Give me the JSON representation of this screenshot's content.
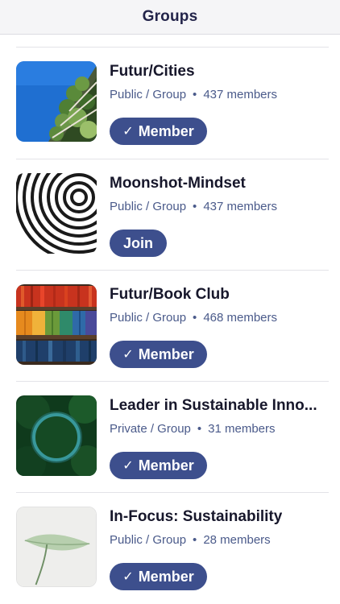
{
  "header": {
    "title": "Groups"
  },
  "colors": {
    "accent": "#3d4f8d",
    "meta_text": "#4a5a8a"
  },
  "groups": [
    {
      "name": "Futur/Cities",
      "visibility": "Public / Group",
      "members": "437 members",
      "button": {
        "label": "Member",
        "state": "member",
        "icon": "checkmark-icon"
      },
      "image": "vertical-forest-building"
    },
    {
      "name": "Moonshot-Mindset",
      "visibility": "Public / Group",
      "members": "437 members",
      "button": {
        "label": "Join",
        "state": "join"
      },
      "image": "spiral-pattern"
    },
    {
      "name": "Futur/Book Club",
      "visibility": "Public / Group",
      "members": "468 members",
      "button": {
        "label": "Member",
        "state": "member",
        "icon": "checkmark-icon"
      },
      "image": "bookshelf"
    },
    {
      "name": "Leader in Sustainable Inno...",
      "visibility": "Private / Group",
      "members": "31 members",
      "button": {
        "label": "Member",
        "state": "member",
        "icon": "checkmark-icon"
      },
      "image": "forest-ring"
    },
    {
      "name": "In-Focus: Sustainability",
      "visibility": "Public / Group",
      "members": "28 members",
      "button": {
        "label": "Member",
        "state": "member",
        "icon": "checkmark-icon"
      },
      "image": "leaf"
    }
  ]
}
